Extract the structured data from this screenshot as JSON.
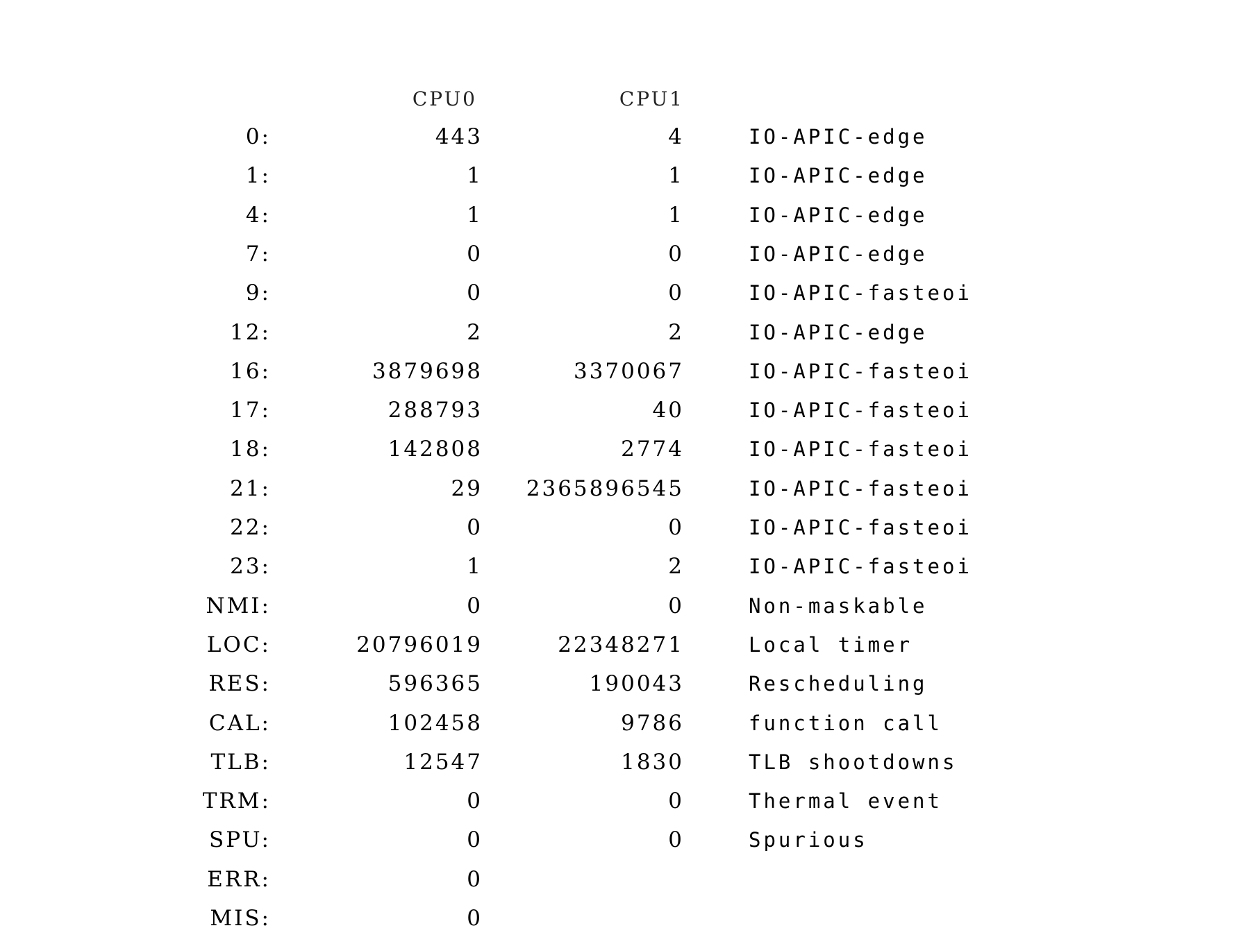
{
  "header": {
    "columns": [
      "CPU0",
      "CPU1"
    ]
  },
  "rows": [
    {
      "irq": "0:",
      "cpu0": "443",
      "cpu1": "4",
      "desc": "IO-APIC-edge"
    },
    {
      "irq": "1:",
      "cpu0": "1",
      "cpu1": "1",
      "desc": "IO-APIC-edge"
    },
    {
      "irq": "4:",
      "cpu0": "1",
      "cpu1": "1",
      "desc": "IO-APIC-edge"
    },
    {
      "irq": "7:",
      "cpu0": "0",
      "cpu1": "0",
      "desc": "IO-APIC-edge"
    },
    {
      "irq": "9:",
      "cpu0": "0",
      "cpu1": "0",
      "desc": "IO-APIC-fasteoi"
    },
    {
      "irq": "12:",
      "cpu0": "2",
      "cpu1": "2",
      "desc": "IO-APIC-edge"
    },
    {
      "irq": "16:",
      "cpu0": "3879698",
      "cpu1": "3370067",
      "desc": "IO-APIC-fasteoi"
    },
    {
      "irq": "17:",
      "cpu0": "288793",
      "cpu1": "40",
      "desc": "IO-APIC-fasteoi"
    },
    {
      "irq": "18:",
      "cpu0": "142808",
      "cpu1": "2774",
      "desc": "IO-APIC-fasteoi"
    },
    {
      "irq": "21:",
      "cpu0": "29",
      "cpu1": "2365896545",
      "desc": "IO-APIC-fasteoi"
    },
    {
      "irq": "22:",
      "cpu0": "0",
      "cpu1": "0",
      "desc": "IO-APIC-fasteoi"
    },
    {
      "irq": "23:",
      "cpu0": "1",
      "cpu1": "2",
      "desc": "IO-APIC-fasteoi"
    },
    {
      "irq": "NMI:",
      "cpu0": "0",
      "cpu1": "0",
      "desc": "Non-maskable"
    },
    {
      "irq": "LOC:",
      "cpu0": "20796019",
      "cpu1": "22348271",
      "desc": "Local timer"
    },
    {
      "irq": "RES:",
      "cpu0": "596365",
      "cpu1": "190043",
      "desc": "Rescheduling"
    },
    {
      "irq": "CAL:",
      "cpu0": "102458",
      "cpu1": "9786",
      "desc": "function call"
    },
    {
      "irq": "TLB:",
      "cpu0": "12547",
      "cpu1": "1830",
      "desc": "TLB shootdowns"
    },
    {
      "irq": "TRM:",
      "cpu0": "0",
      "cpu1": "0",
      "desc": "Thermal event"
    },
    {
      "irq": "SPU:",
      "cpu0": "0",
      "cpu1": "0",
      "desc": "Spurious"
    },
    {
      "irq": "ERR:",
      "cpu0": "0",
      "cpu1": "",
      "desc": ""
    },
    {
      "irq": "MIS:",
      "cpu0": "0",
      "cpu1": "",
      "desc": ""
    }
  ]
}
